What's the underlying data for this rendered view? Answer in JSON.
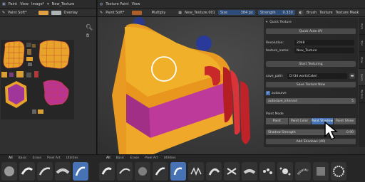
{
  "uv_header": {
    "mode": "Paint",
    "view": "View",
    "image": "Image*",
    "texture_name": "New_Texture",
    "brush": "Paint Soft*",
    "overlay": "Overlay",
    "primary_color": "#e0a040",
    "secondary_color": "#aeb3b5"
  },
  "viewport_header": {
    "mode": "Texture Paint",
    "view": "View",
    "brush": "Paint Soft*",
    "blend": "Multiply",
    "texture": "New_Texture.001",
    "size_label": "Size",
    "size_value": "384 px",
    "strength_label": "Strength",
    "strength_value": "0.330",
    "brush_menu": "Brush",
    "texture_menu": "Texture",
    "texture_mask_menu": "Texture Mask",
    "color": "#b05e25"
  },
  "quick_texture": {
    "title": "Quick Texture",
    "quick_auto_uv": "Quick Auto UV",
    "resolution_label": "Resolution:",
    "resolution_value": "2048",
    "texture_name_label": "texture_name:",
    "texture_name_value": "New_Texture",
    "start_texturing": "Start Texturing",
    "save_path_label": "save_path:",
    "save_path_value": "D:\\3d work\\Cake\\",
    "save_texture_now": "Save Texture Now",
    "autosave_label": "autosave",
    "autosave_checked": true,
    "autosave_interval_label": "autosave_interval:",
    "autosave_interval_value": "5",
    "paint_mode_label": "Paint Mode",
    "paint_modes": [
      "Paint",
      "Paint Color",
      "Paint Shadow",
      "Paint Shine"
    ],
    "active_paint_mode": "Paint Shadow",
    "shadow_strength_label": "Shadow Strength",
    "shadow_strength_value": "0.90",
    "add_shadows": "Add Shadows (40)"
  },
  "side_tabs": [
    "Item",
    "Tool",
    "View",
    "Quick",
    "Texture"
  ],
  "left_shelf": {
    "tabs": [
      "All",
      "Basic",
      "Erase",
      "Pixel Art",
      "Utilities"
    ],
    "active_tab": "All"
  },
  "right_shelf": {
    "tabs": [
      "All",
      "Basic",
      "Erase",
      "Pixel Art",
      "Utilities"
    ],
    "active_tab": "All"
  }
}
